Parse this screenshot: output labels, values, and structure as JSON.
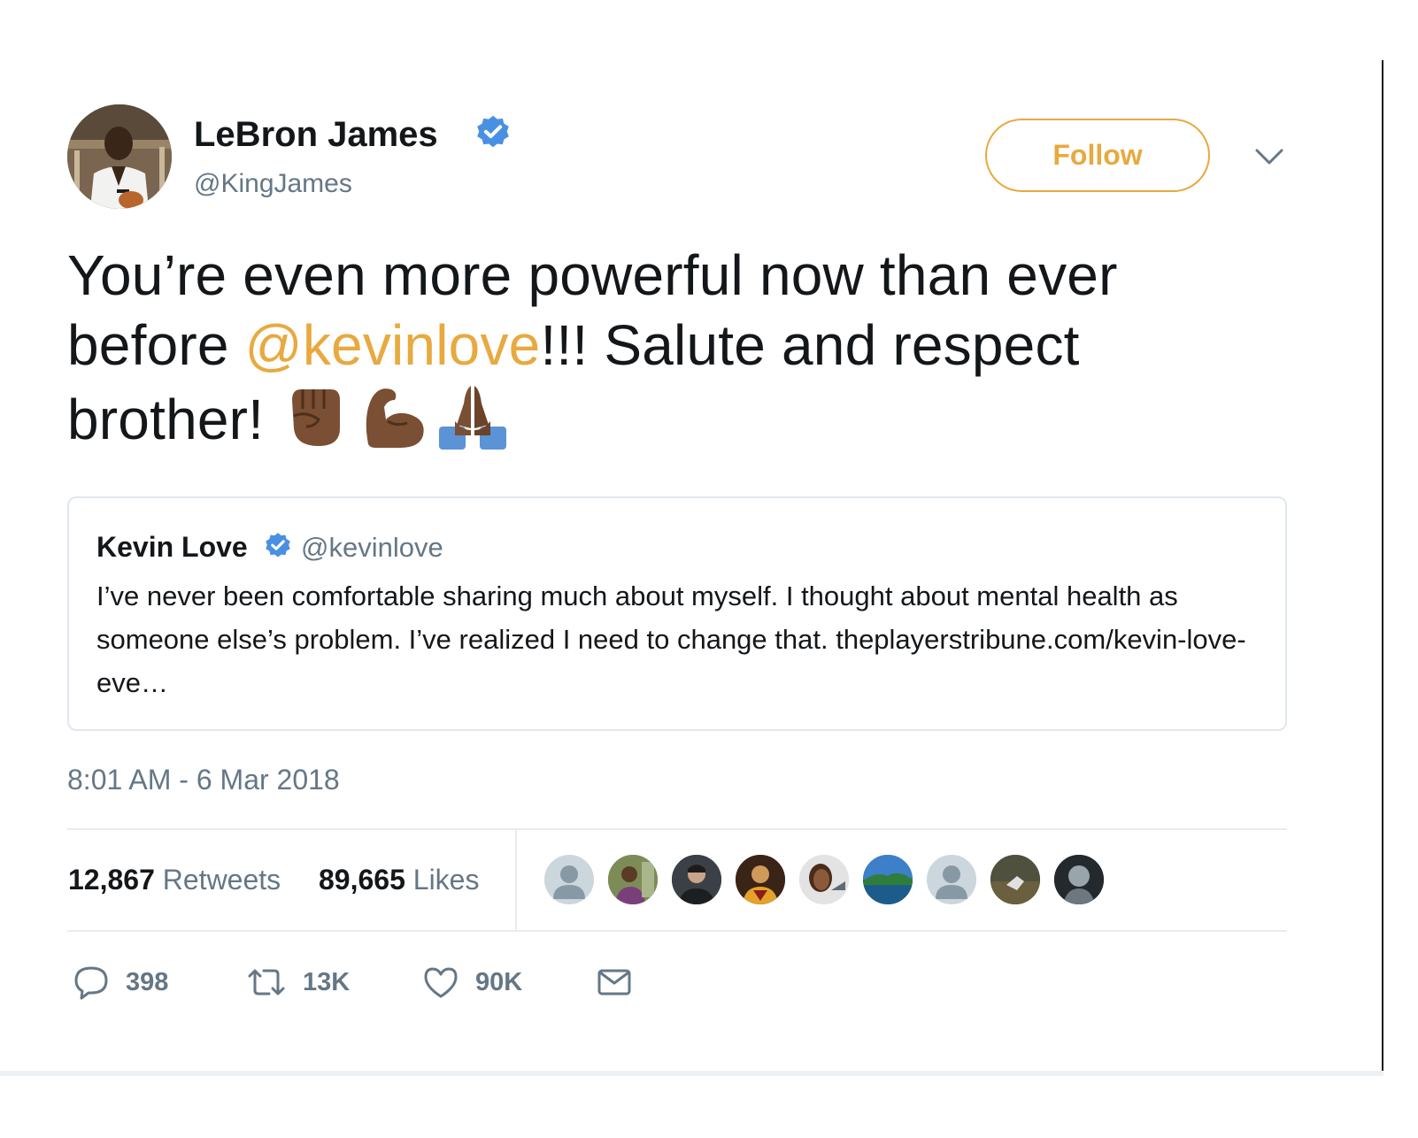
{
  "tweet": {
    "author": {
      "name": "LeBron James",
      "handle": "@KingJames",
      "verified": true
    },
    "follow_label": "Follow",
    "text_before": "You’re even more powerful now than ever before ",
    "mention": "@kevinlove",
    "text_after": "!!! Salute and respect brother! ",
    "emojis": [
      "raised-fist-icon",
      "flexed-biceps-icon",
      "folded-hands-icon"
    ],
    "timestamp": "8:01 AM - 6 Mar 2018"
  },
  "quoted": {
    "name": "Kevin Love",
    "handle": "@kevinlove",
    "verified": true,
    "text": "I’ve never been comfortable sharing much about myself. I thought about mental health as someone else’s problem. I’ve realized I need to change that. theplayerstribune.com/kevin-love-eve…"
  },
  "stats": {
    "retweets_count": "12,867",
    "retweets_label": "Retweets",
    "likes_count": "89,665",
    "likes_label": "Likes"
  },
  "liker_avatars": [
    "default-avatar",
    "photo-avatar",
    "photo-avatar",
    "photo-avatar",
    "photo-avatar",
    "photo-avatar",
    "default-avatar",
    "photo-avatar",
    "photo-avatar"
  ],
  "actions": {
    "replies": "398",
    "retweets": "13K",
    "likes": "90K"
  },
  "colors": {
    "accent": "#e8a93f",
    "verified": "#4a90e2",
    "muted": "#657786",
    "text": "#14171a",
    "border": "#e1e8ed"
  }
}
